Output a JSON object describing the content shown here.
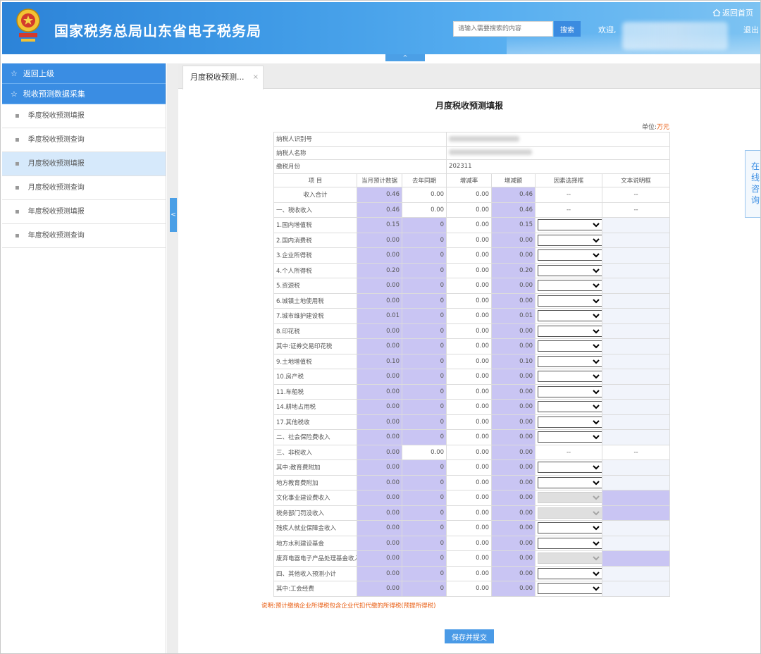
{
  "header": {
    "title": "国家税务总局山东省电子税务局",
    "search_placeholder": "请输入需要搜索的内容",
    "search_button": "搜索",
    "welcome": "欢迎,",
    "home_link": "返回首页",
    "logout": "退出",
    "collapse_icon": "^"
  },
  "sidebar": {
    "back_label": "返回上级",
    "group_label": "税收预测数据采集",
    "items": [
      {
        "label": "季度税收预测填报",
        "active": false
      },
      {
        "label": "季度税收预测查询",
        "active": false
      },
      {
        "label": "月度税收预测填报",
        "active": true
      },
      {
        "label": "月度税收预测查询",
        "active": false
      },
      {
        "label": "年度税收预测填报",
        "active": false
      },
      {
        "label": "年度税收预测查询",
        "active": false
      }
    ],
    "toggle_icon": "<"
  },
  "tabs": [
    {
      "label": "月度税收预测...",
      "close": "×"
    }
  ],
  "form": {
    "title": "月度税收预测填报",
    "unit_label": "单位:",
    "unit_value": "万元",
    "info": {
      "taxpayer_id_label": "纳税人识别号",
      "taxpayer_name_label": "纳税人名称",
      "period_label": "缴税月份",
      "period_value": "202311"
    },
    "columns": [
      "项 目",
      "当月预计数据",
      "去年同期",
      "增减率",
      "增减额",
      "因素选择框",
      "文本说明框"
    ],
    "rows": [
      {
        "label": "收入合计",
        "cur": "0.46",
        "last": "0.00",
        "rate": "0.00",
        "diff": "0.46",
        "factor": "--",
        "text": "--"
      },
      {
        "label": "一、税收收入",
        "cur": "0.46",
        "last": "0.00",
        "rate": "0.00",
        "diff": "0.46",
        "factor": "--",
        "text": "--"
      },
      {
        "label": "1.国内增值税",
        "cur": "0.15",
        "last": "0",
        "rate": "0.00",
        "diff": "0.15"
      },
      {
        "label": "2.国内消费税",
        "cur": "0.00",
        "last": "0",
        "rate": "0.00",
        "diff": "0.00"
      },
      {
        "label": "3.企业所得税",
        "cur": "0.00",
        "last": "0",
        "rate": "0.00",
        "diff": "0.00"
      },
      {
        "label": "4.个人所得税",
        "cur": "0.20",
        "last": "0",
        "rate": "0.00",
        "diff": "0.20"
      },
      {
        "label": "5.资源税",
        "cur": "0.00",
        "last": "0",
        "rate": "0.00",
        "diff": "0.00"
      },
      {
        "label": "6.城镇土地使用税",
        "cur": "0.00",
        "last": "0",
        "rate": "0.00",
        "diff": "0.00"
      },
      {
        "label": "7.城市维护建设税",
        "cur": "0.01",
        "last": "0",
        "rate": "0.00",
        "diff": "0.01"
      },
      {
        "label": "8.印花税",
        "cur": "0.00",
        "last": "0",
        "rate": "0.00",
        "diff": "0.00"
      },
      {
        "label": "其中:证券交易印花税",
        "cur": "0.00",
        "last": "0",
        "rate": "0.00",
        "diff": "0.00"
      },
      {
        "label": "9.土地增值税",
        "cur": "0.10",
        "last": "0",
        "rate": "0.00",
        "diff": "0.10"
      },
      {
        "label": "10.房产税",
        "cur": "0.00",
        "last": "0",
        "rate": "0.00",
        "diff": "0.00"
      },
      {
        "label": "11.车船税",
        "cur": "0.00",
        "last": "0",
        "rate": "0.00",
        "diff": "0.00"
      },
      {
        "label": "14.耕地占用税",
        "cur": "0.00",
        "last": "0",
        "rate": "0.00",
        "diff": "0.00"
      },
      {
        "label": "17.其他税收",
        "cur": "0.00",
        "last": "0",
        "rate": "0.00",
        "diff": "0.00"
      },
      {
        "label": "二、社会保险费收入",
        "cur": "0.00",
        "last": "0",
        "rate": "0.00",
        "diff": "0.00"
      },
      {
        "label": "三、非税收入",
        "cur": "0.00",
        "last": "0.00",
        "rate": "0.00",
        "diff": "0.00",
        "factor": "--",
        "text": "--"
      },
      {
        "label": "其中:教育费附加",
        "cur": "0.00",
        "last": "0",
        "rate": "0.00",
        "diff": "0.00"
      },
      {
        "label": "地方教育费附加",
        "cur": "0.00",
        "last": "0",
        "rate": "0.00",
        "diff": "0.00"
      },
      {
        "label": "文化事业建设费收入",
        "cur": "0.00",
        "last": "0",
        "rate": "0.00",
        "diff": "0.00",
        "disabled": true
      },
      {
        "label": "税务部门罚没收入",
        "cur": "0.00",
        "last": "0",
        "rate": "0.00",
        "diff": "0.00",
        "disabled": true
      },
      {
        "label": "残疾人就业保障金收入",
        "cur": "0.00",
        "last": "0",
        "rate": "0.00",
        "diff": "0.00"
      },
      {
        "label": "地方水利建设基金",
        "cur": "0.00",
        "last": "0",
        "rate": "0.00",
        "diff": "0.00"
      },
      {
        "label": "废弃电器电子产品处理基金收入",
        "cur": "0.00",
        "last": "0",
        "rate": "0.00",
        "diff": "0.00",
        "disabled": true
      },
      {
        "label": "四、其他收入预测小计",
        "cur": "0.00",
        "last": "0",
        "rate": "0.00",
        "diff": "0.00"
      },
      {
        "label": "其中:工会经费",
        "cur": "0.00",
        "last": "0",
        "rate": "0.00",
        "diff": "0.00"
      }
    ],
    "note": "说明:预计缴纳企业所得税包含企业代扣代缴的所得税(预提所得税)",
    "save_button": "保存并提交"
  },
  "consult": {
    "label": "在线咨询"
  },
  "colors": {
    "header_blue": "#3a8de3",
    "purple_cell": "#c9c5f3",
    "accent_orange": "#e8590c",
    "active_item": "#d6e9fb"
  }
}
